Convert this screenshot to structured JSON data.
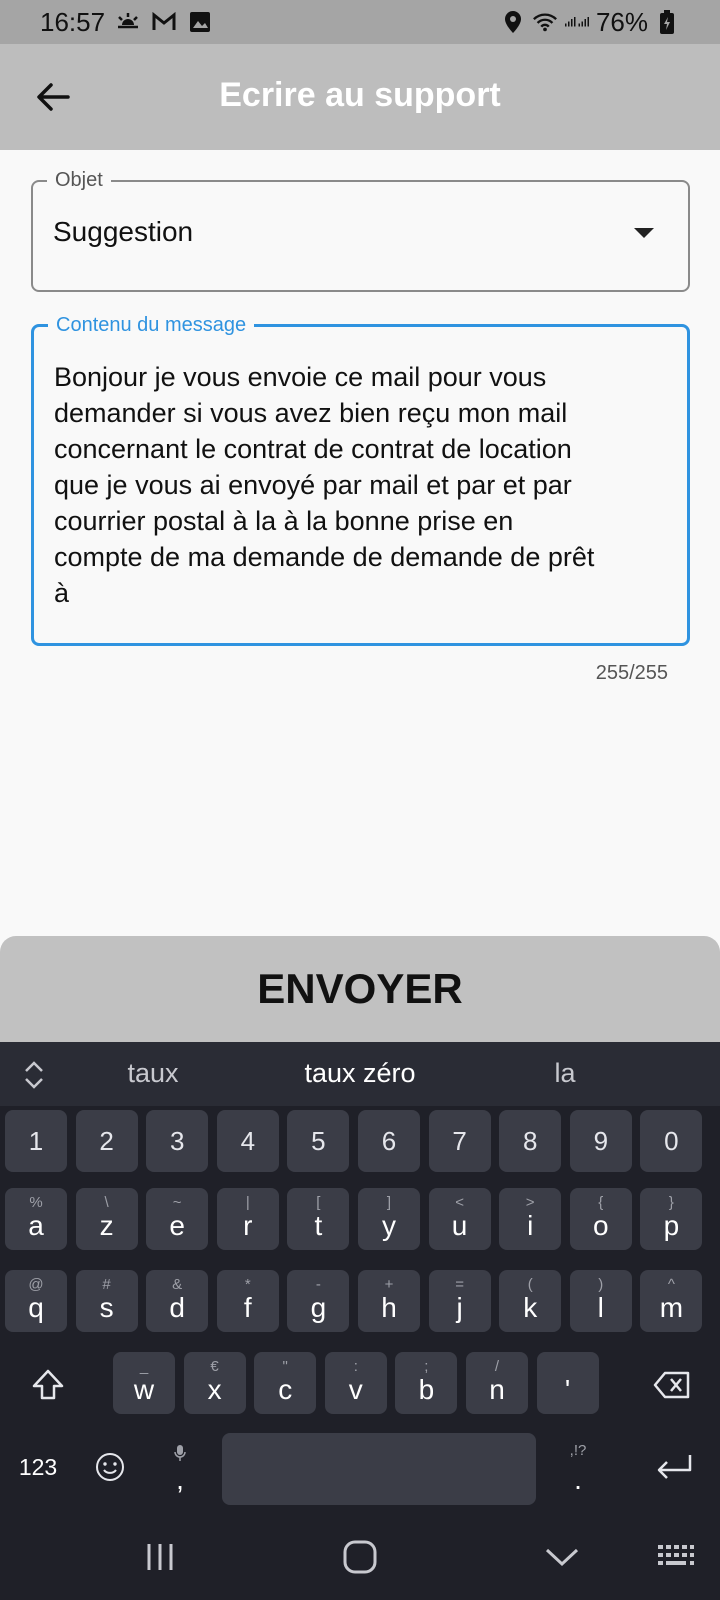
{
  "status_bar": {
    "time": "16:57",
    "battery": "76%",
    "icons": [
      "weather-icon",
      "gmail-icon",
      "gallery-icon",
      "location-icon",
      "wifi-icon",
      "signal-icon",
      "battery-icon"
    ]
  },
  "app_bar": {
    "title": "Ecrire au support",
    "back_icon": "arrow-left-icon"
  },
  "form": {
    "object_label": "Objet",
    "object_value": "Suggestion",
    "message_label": "Contenu du message",
    "message_value": "Bonjour je vous envoie ce mail pour vous\ndemander si vous avez bien reçu mon mail\nconcernant le contrat de contrat de location\nque je vous ai envoyé par mail et par et par\ncourrier postal à la à la bonne prise en\ncompte de ma demande de demande de prêt\nà",
    "counter": "255/255",
    "accent_color": "#2f93e0"
  },
  "send_button": {
    "label": "ENVOYER"
  },
  "keyboard": {
    "suggestions": [
      "taux",
      "taux zéro",
      "la"
    ],
    "numbers": [
      "1",
      "2",
      "3",
      "4",
      "5",
      "6",
      "7",
      "8",
      "9",
      "0"
    ],
    "row1": [
      {
        "k": "a",
        "h": "%"
      },
      {
        "k": "z",
        "h": "\\"
      },
      {
        "k": "e",
        "h": "~"
      },
      {
        "k": "r",
        "h": "|"
      },
      {
        "k": "t",
        "h": "["
      },
      {
        "k": "y",
        "h": "]"
      },
      {
        "k": "u",
        "h": "<"
      },
      {
        "k": "i",
        "h": ">"
      },
      {
        "k": "o",
        "h": "{"
      },
      {
        "k": "p",
        "h": "}"
      }
    ],
    "row2": [
      {
        "k": "q",
        "h": "@"
      },
      {
        "k": "s",
        "h": "#"
      },
      {
        "k": "d",
        "h": "&"
      },
      {
        "k": "f",
        "h": "*"
      },
      {
        "k": "g",
        "h": "-"
      },
      {
        "k": "h",
        "h": "+"
      },
      {
        "k": "j",
        "h": "="
      },
      {
        "k": "k",
        "h": "("
      },
      {
        "k": "l",
        "h": ")"
      },
      {
        "k": "m",
        "h": "^"
      }
    ],
    "row3": [
      {
        "k": "w",
        "h": "_"
      },
      {
        "k": "x",
        "h": "€"
      },
      {
        "k": "c",
        "h": "\""
      },
      {
        "k": "v",
        "h": ":"
      },
      {
        "k": "b",
        "h": ";"
      },
      {
        "k": "n",
        "h": "/"
      },
      {
        "k": "'",
        "h": ""
      }
    ],
    "mode_label": "123",
    "comma": ",",
    "period": ".",
    "period_hint": ",!?"
  }
}
